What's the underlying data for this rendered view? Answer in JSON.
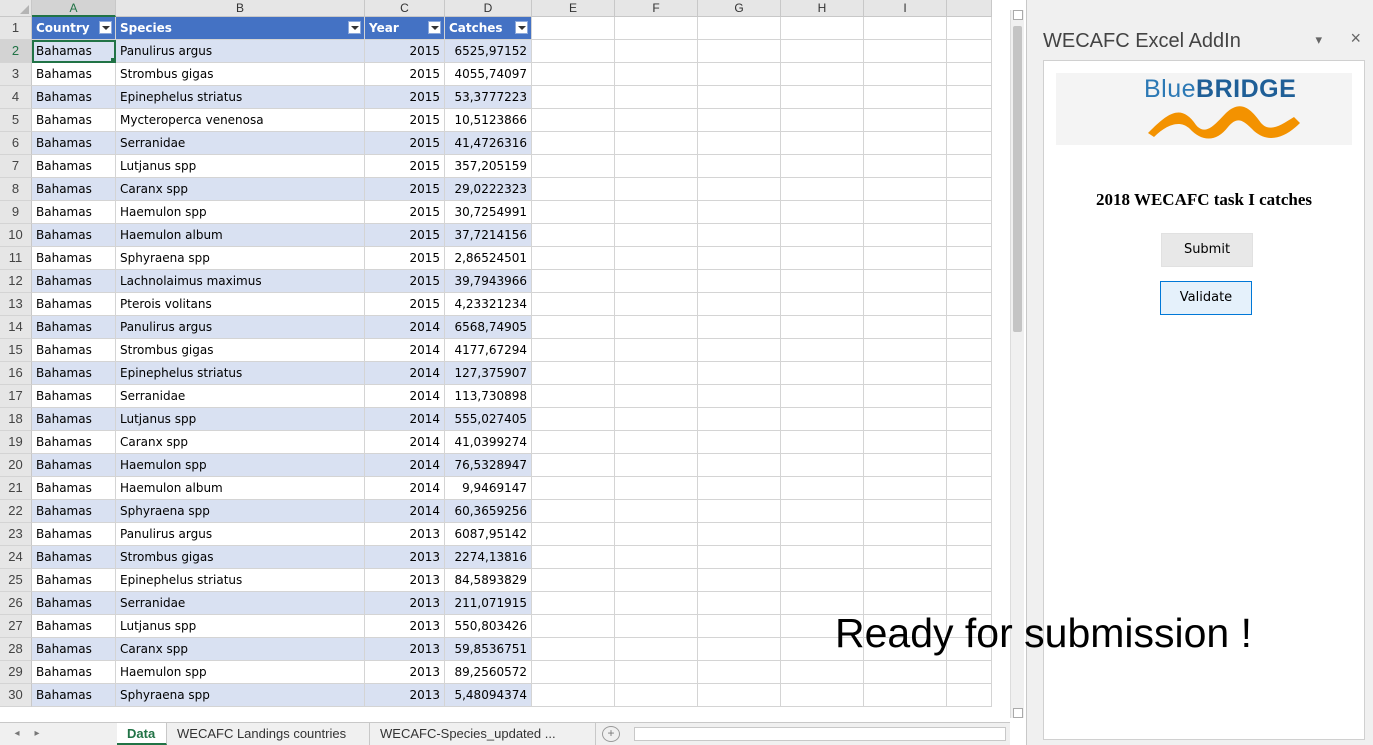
{
  "sheet": {
    "columns": [
      "A",
      "B",
      "C",
      "D",
      "E",
      "F",
      "G",
      "H",
      "I"
    ],
    "row_numbers": [
      "1",
      "2",
      "3",
      "4",
      "5",
      "6",
      "7",
      "8",
      "9",
      "10",
      "11",
      "12",
      "13",
      "14",
      "15",
      "16",
      "17",
      "18",
      "19",
      "20",
      "21",
      "22",
      "23",
      "24",
      "25",
      "26",
      "27",
      "28",
      "29",
      "30"
    ],
    "headers": {
      "country": "Country",
      "species": "Species",
      "year": "Year",
      "catches": "Catches"
    },
    "rows": [
      [
        "Bahamas",
        "Panulirus argus",
        "2015",
        "6525,97152"
      ],
      [
        "Bahamas",
        "Strombus gigas",
        "2015",
        "4055,74097"
      ],
      [
        "Bahamas",
        "Epinephelus striatus",
        "2015",
        "53,3777223"
      ],
      [
        "Bahamas",
        "Mycteroperca venenosa",
        "2015",
        "10,5123866"
      ],
      [
        "Bahamas",
        "Serranidae",
        "2015",
        "41,4726316"
      ],
      [
        "Bahamas",
        "Lutjanus spp",
        "2015",
        "357,205159"
      ],
      [
        "Bahamas",
        "Caranx spp",
        "2015",
        "29,0222323"
      ],
      [
        "Bahamas",
        "Haemulon spp",
        "2015",
        "30,7254991"
      ],
      [
        "Bahamas",
        "Haemulon album",
        "2015",
        "37,7214156"
      ],
      [
        "Bahamas",
        "Sphyraena spp",
        "2015",
        "2,86524501"
      ],
      [
        "Bahamas",
        "Lachnolaimus maximus",
        "2015",
        "39,7943966"
      ],
      [
        "Bahamas",
        "Pterois volitans",
        "2015",
        "4,23321234"
      ],
      [
        "Bahamas",
        "Panulirus argus",
        "2014",
        "6568,74905"
      ],
      [
        "Bahamas",
        "Strombus gigas",
        "2014",
        "4177,67294"
      ],
      [
        "Bahamas",
        "Epinephelus striatus",
        "2014",
        "127,375907"
      ],
      [
        "Bahamas",
        "Serranidae",
        "2014",
        "113,730898"
      ],
      [
        "Bahamas",
        "Lutjanus spp",
        "2014",
        "555,027405"
      ],
      [
        "Bahamas",
        "Caranx spp",
        "2014",
        "41,0399274"
      ],
      [
        "Bahamas",
        "Haemulon spp",
        "2014",
        "76,5328947"
      ],
      [
        "Bahamas",
        "Haemulon album",
        "2014",
        "9,9469147"
      ],
      [
        "Bahamas",
        "Sphyraena spp",
        "2014",
        "60,3659256"
      ],
      [
        "Bahamas",
        "Panulirus argus",
        "2013",
        "6087,95142"
      ],
      [
        "Bahamas",
        "Strombus gigas",
        "2013",
        "2274,13816"
      ],
      [
        "Bahamas",
        "Epinephelus striatus",
        "2013",
        "84,5893829"
      ],
      [
        "Bahamas",
        "Serranidae",
        "2013",
        "211,071915"
      ],
      [
        "Bahamas",
        "Lutjanus spp",
        "2013",
        "550,803426"
      ],
      [
        "Bahamas",
        "Caranx spp",
        "2013",
        "59,8536751"
      ],
      [
        "Bahamas",
        "Haemulon spp",
        "2013",
        "89,2560572"
      ],
      [
        "Bahamas",
        "Sphyraena spp",
        "2013",
        "5,48094374"
      ]
    ],
    "tabs": [
      "Data",
      "WECAFC Landings countries",
      "WECAFC-Species_updated"
    ],
    "tab_overflow": "...",
    "add_sheet": "+",
    "nav_next": "▸"
  },
  "addin": {
    "title": "WECAFC Excel AddIn",
    "menu_icon": "▾",
    "close_icon": "×",
    "logo_blue": "Blue",
    "logo_bridge": "BRIDGE",
    "task_title": "2018 WECAFC task I catches",
    "submit_label": "Submit",
    "validate_label": "Validate"
  },
  "status_message": "Ready for submission !",
  "colors": {
    "header_blue": "#4472c4",
    "band_blue": "#d9e1f2",
    "excel_green": "#217346",
    "logo_orange": "#f39200"
  }
}
